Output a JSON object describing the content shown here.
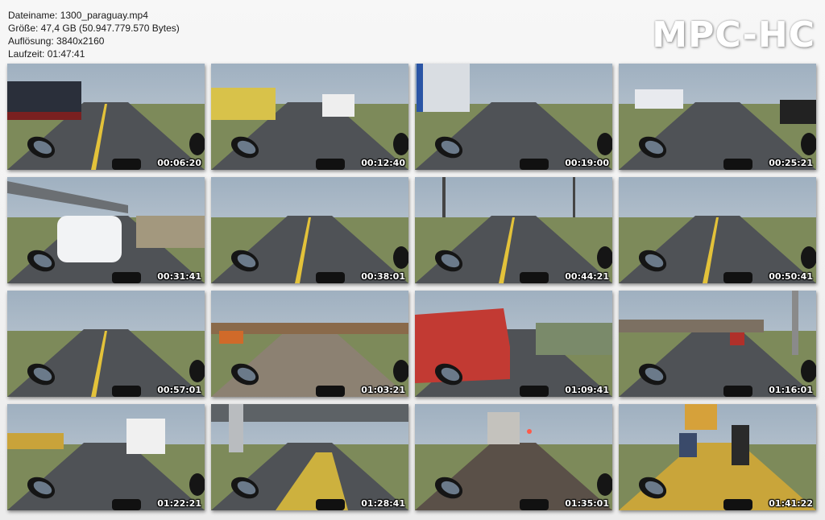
{
  "file_info": {
    "name_line": "Dateiname: 1300_paraguay.mp4",
    "size_line": "Größe: 47,4 GB (50.947.779.570 Bytes)",
    "resolution_line": "Auflösung: 3840x2160",
    "duration_line": "Laufzeit: 01:47:41"
  },
  "logo": "MPC-HC",
  "thumbnails": [
    {
      "time": "00:06:20",
      "scene": "trucks-left"
    },
    {
      "time": "00:12:40",
      "scene": "traffic-pickup"
    },
    {
      "time": "00:19:00",
      "scene": "building-left"
    },
    {
      "time": "00:25:21",
      "scene": "bus-traffic"
    },
    {
      "time": "00:31:41",
      "scene": "overpass-car"
    },
    {
      "time": "00:38:01",
      "scene": "open-road"
    },
    {
      "time": "00:44:21",
      "scene": "towers-road"
    },
    {
      "time": "00:50:41",
      "scene": "open-road"
    },
    {
      "time": "00:57:01",
      "scene": "open-road"
    },
    {
      "time": "01:03:21",
      "scene": "dirt-town"
    },
    {
      "time": "01:09:41",
      "scene": "red-pickup"
    },
    {
      "time": "01:16:01",
      "scene": "market-road"
    },
    {
      "time": "01:22:21",
      "scene": "city-bus"
    },
    {
      "time": "01:28:41",
      "scene": "underpass"
    },
    {
      "time": "01:35:01",
      "scene": "dusk-street"
    },
    {
      "time": "01:41:22",
      "scene": "night-bikes"
    }
  ],
  "colors": {
    "sky": "#c9d1d9",
    "asphalt": "#4f5256",
    "grass": "#4e7a35",
    "lane_yellow": "#e3c23a"
  }
}
